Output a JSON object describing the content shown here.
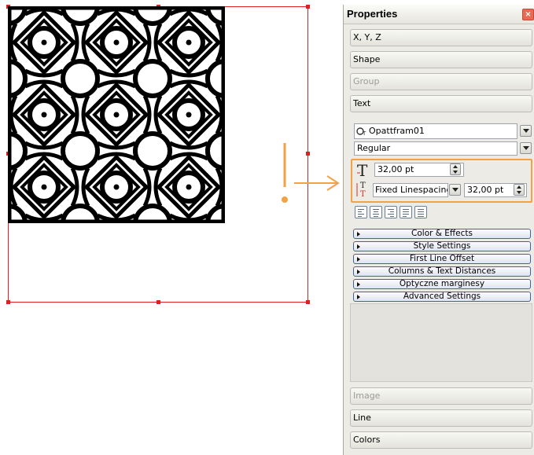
{
  "panel": {
    "title": "Properties",
    "close_icon": "close-icon",
    "sections_top": [
      "X, Y, Z",
      "Shape",
      "Group",
      "Text"
    ],
    "sections_bottom": [
      "Image",
      "Line",
      "Colors"
    ],
    "disabled_sections": [
      "Group",
      "Image"
    ]
  },
  "text": {
    "font_name": "Opattfram01",
    "font_style": "Regular",
    "font_size": "32,00 pt",
    "linespacing_mode": "Fixed Linespacing",
    "linespacing_value": "32,00 pt",
    "alignment_buttons": [
      "align-left-icon",
      "align-center-icon",
      "align-right-icon",
      "align-block-icon",
      "align-forced-icon"
    ],
    "subsections": [
      "Color & Effects",
      "Style Settings",
      "First Line Offset",
      "Columns & Text Distances",
      "Optyczne marginesy",
      "Advanced Settings"
    ]
  },
  "annotation": {
    "mark": "!",
    "color": "#f2a245"
  },
  "colors": {
    "selection": "#e02020",
    "highlight": "#f2a245",
    "panel_bg": "#ecebe5"
  }
}
